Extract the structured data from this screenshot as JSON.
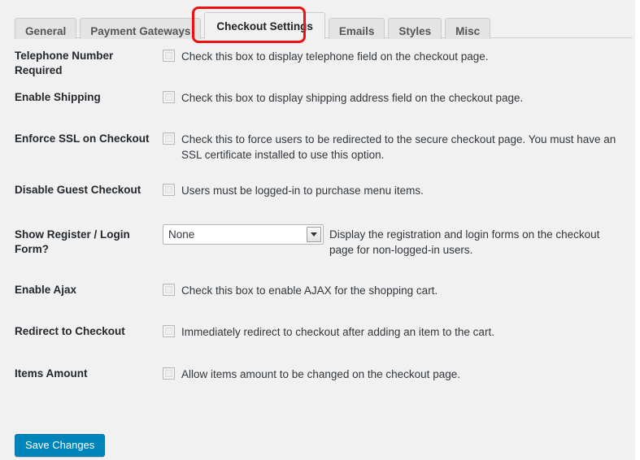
{
  "tabs": [
    {
      "label": "General",
      "active": false
    },
    {
      "label": "Payment Gateways",
      "active": false
    },
    {
      "label": "Checkout Settings",
      "active": true
    },
    {
      "label": "Emails",
      "active": false
    },
    {
      "label": "Styles",
      "active": false
    },
    {
      "label": "Misc",
      "active": false
    }
  ],
  "highlight": {
    "color": "#ee1111",
    "target": "Checkout Settings"
  },
  "settings": [
    {
      "label": "Telephone Number Required",
      "type": "checkbox",
      "checked": false,
      "description": "Check this box to display telephone field on the checkout page."
    },
    {
      "label": "Enable Shipping",
      "type": "checkbox",
      "checked": false,
      "description": "Check this box to display shipping address field on the checkout page."
    },
    {
      "label": "Enforce SSL on Checkout",
      "type": "checkbox",
      "checked": false,
      "description": "Check this to force users to be redirected to the secure checkout page. You must have an SSL certificate installed to use this option."
    },
    {
      "label": "Disable Guest Checkout",
      "type": "checkbox",
      "checked": false,
      "description": "Users must be logged-in to purchase menu items."
    },
    {
      "label": "Show Register / Login Form?",
      "type": "select",
      "value": "None",
      "options": [
        "None"
      ],
      "description": "Display the registration and login forms on the checkout page for non-logged-in users."
    },
    {
      "label": "Enable Ajax",
      "type": "checkbox",
      "checked": false,
      "description": "Check this box to enable AJAX for the shopping cart."
    },
    {
      "label": "Redirect to Checkout",
      "type": "checkbox",
      "checked": false,
      "description": "Immediately redirect to checkout after adding an item to the cart."
    },
    {
      "label": "Items Amount",
      "type": "checkbox",
      "checked": false,
      "description": "Allow items amount to be changed on the checkout page."
    }
  ],
  "footer": {
    "save_label": "Save Changes",
    "save_color": "#0085ba"
  }
}
